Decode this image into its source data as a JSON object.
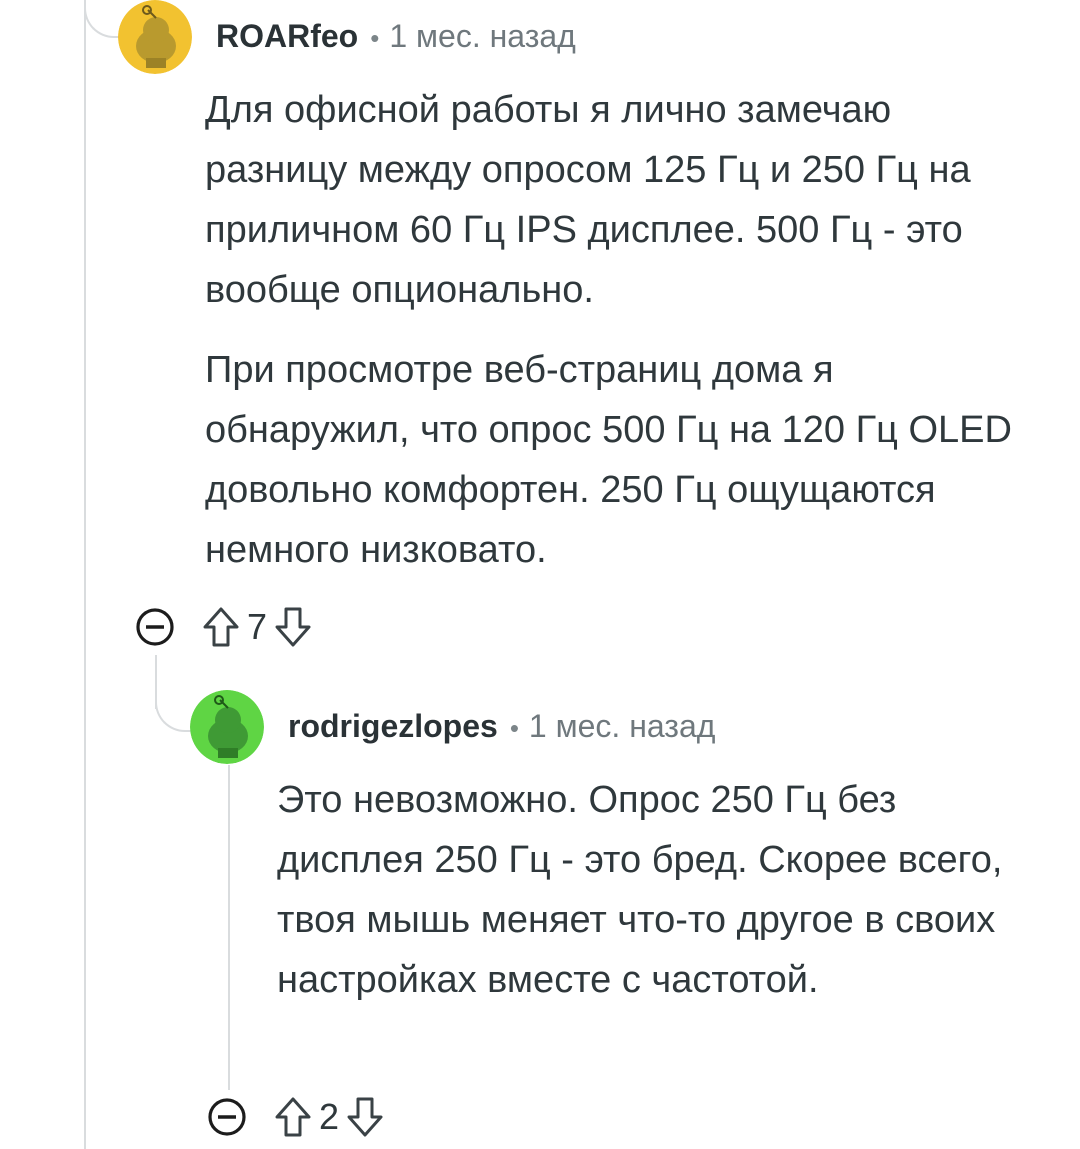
{
  "comments": [
    {
      "author": "ROARfeo",
      "separator": "•",
      "time": "1 мес. назад",
      "avatar_color": "#f2c230",
      "paragraphs": [
        "Для офисной работы я лично замечаю разницу между опросом 125 Гц и 250 Гц на приличном 60 Гц IPS дисплее. 500 Гц - это вообще опционально.",
        "При просмотре веб-страниц дома я обнаружил, что опрос 500 Гц на 120 Гц OLED довольно комфортен. 250 Гц ощущаются немного низковато."
      ],
      "score": "7"
    },
    {
      "author": "rodrigezlopes",
      "separator": "•",
      "time": "1 мес. назад",
      "avatar_color": "#5fd544",
      "paragraphs": [
        "Это невозможно. Опрос 250 Гц без дисплея 250 Гц - это бред. Скорее всего, твоя мышь меняет что-то другое в своих настройках вместе с частотой."
      ],
      "score": "2"
    }
  ],
  "colors": {
    "thread_line": "#d9dcde",
    "text": "#2a3236",
    "muted": "#6f787d"
  },
  "icons": [
    "collapse-icon",
    "upvote-icon",
    "downvote-icon",
    "snoo-avatar"
  ]
}
